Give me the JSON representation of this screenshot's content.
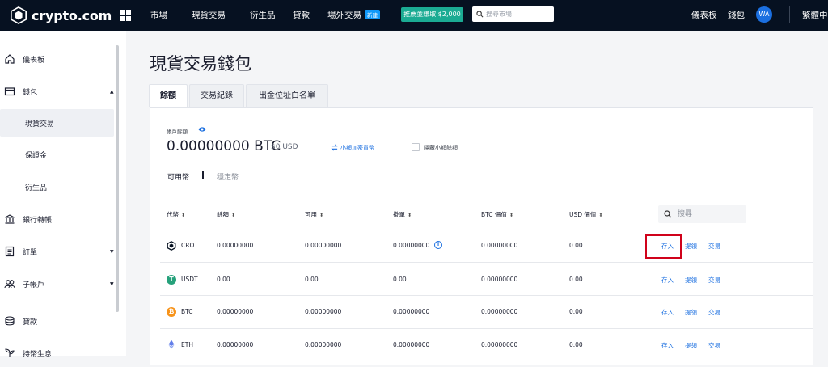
{
  "topbar": {
    "logo_text": "crypto.com",
    "nav": [
      "市場",
      "現貨交易",
      "衍生品",
      "貸款",
      "場外交易"
    ],
    "new_badge": "新建",
    "promo": "推薦並賺取 $2,000",
    "search_placeholder": "搜尋市場",
    "dashboard": "儀表板",
    "wallet": "錢包",
    "avatar_initials": "WA",
    "language": "繁體中"
  },
  "sidebar": {
    "items": [
      "儀表板",
      "錢包",
      "現貨交易",
      "保證金",
      "衍生品",
      "銀行轉帳",
      "訂單",
      "子帳戶",
      "貸款",
      "持幣生息"
    ]
  },
  "page": {
    "title": "現貨交易錢包",
    "tabs": [
      "餘額",
      "交易紀錄",
      "出金位址白名單"
    ]
  },
  "balance": {
    "label": "帳戶餘額",
    "btc": "0.00000000 BTC",
    "usd": "$0 USD",
    "convert_label": "小額加密貨幣",
    "hide_small_label": "隱藏小額餘額",
    "sub_tabs": [
      "可用幣",
      "穩定幣"
    ]
  },
  "table": {
    "headers": [
      "代幣",
      "餘額",
      "可用",
      "掛單",
      "BTC 價值",
      "USD 價值"
    ],
    "search_placeholder": "搜尋",
    "actions": [
      "存入",
      "提領",
      "交易"
    ],
    "rows": [
      {
        "coin": "CRO",
        "balance": "0.00000000",
        "available": "0.00000000",
        "orders": "0.00000000",
        "btc_value": "0.00000000",
        "usd_value": "0.00"
      },
      {
        "coin": "USDT",
        "balance": "0.00",
        "available": "0.00",
        "orders": "0.00",
        "btc_value": "0.00000000",
        "usd_value": "0.00"
      },
      {
        "coin": "BTC",
        "balance": "0.00000000",
        "available": "0.00000000",
        "orders": "0.00000000",
        "btc_value": "0.00000000",
        "usd_value": "0.00"
      },
      {
        "coin": "ETH",
        "balance": "0.00000000",
        "available": "0.00000000",
        "orders": "0.00000000",
        "btc_value": "0.00000000",
        "usd_value": "0.00"
      }
    ]
  },
  "colors": {
    "topbar": "#061121",
    "accent": "#1b6fe0",
    "promo": "#1bab93",
    "highlight": "#d0021b"
  }
}
